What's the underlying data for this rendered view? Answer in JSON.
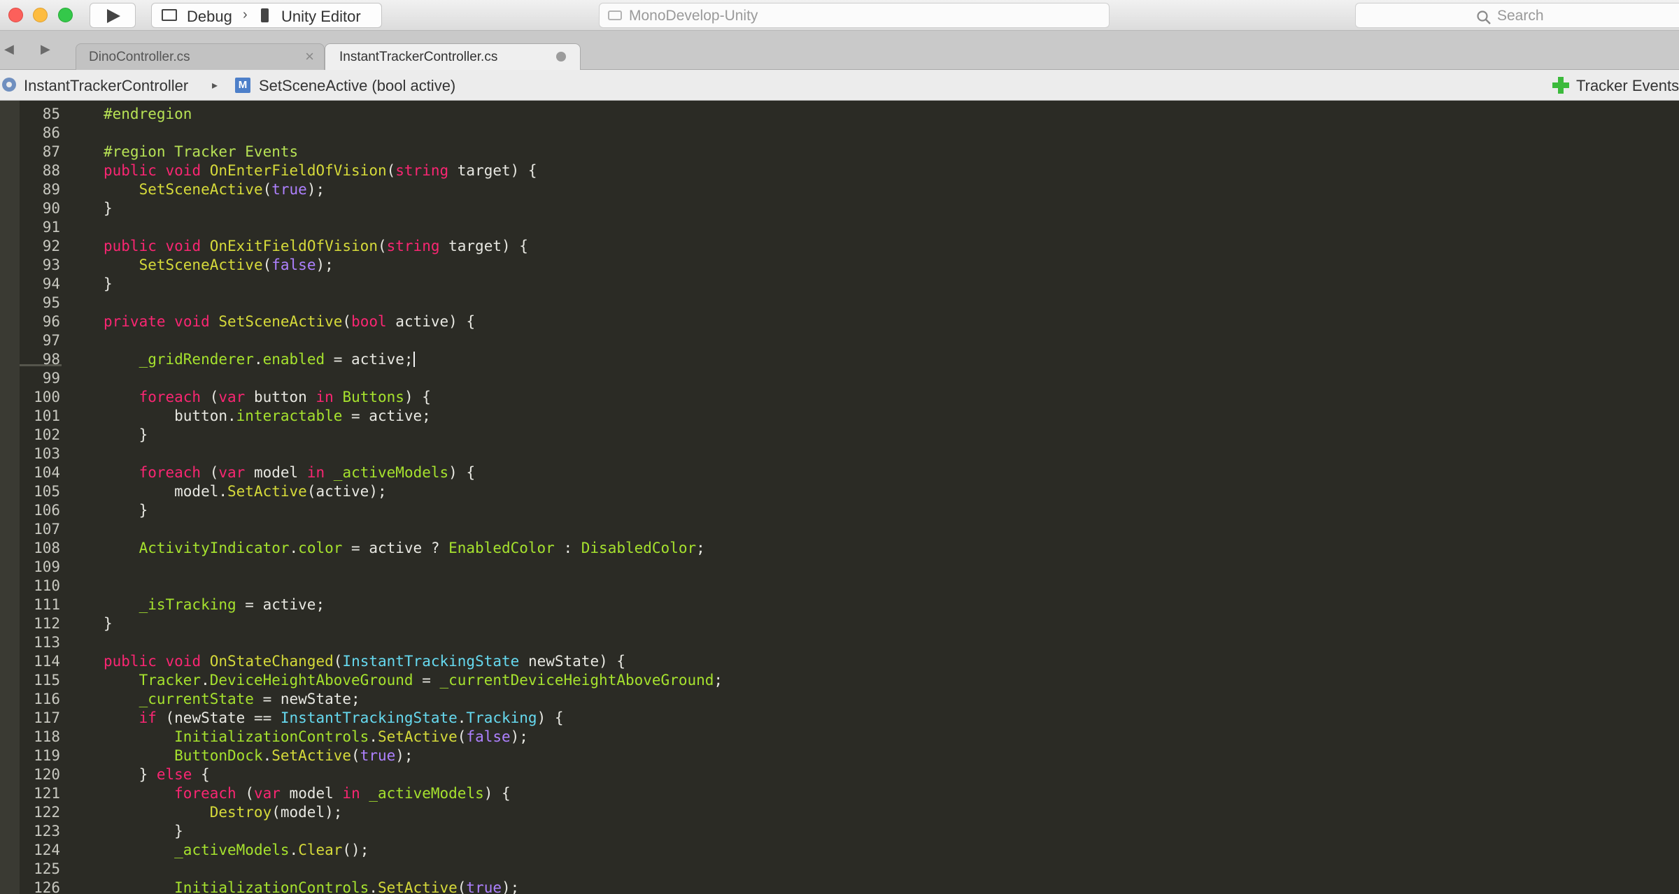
{
  "toolbar": {
    "config": "Debug",
    "separator": "›",
    "target": "Unity Editor",
    "app_title": "MonoDevelop-Unity",
    "search_placeholder": "Search"
  },
  "tabs": [
    {
      "label": "DinoController.cs",
      "close": "×"
    },
    {
      "label": "InstantTrackerController.cs"
    }
  ],
  "nav": {
    "back": "◀",
    "forward": "▶"
  },
  "breadcrumb": {
    "class_name": "InstantTrackerController",
    "arrow": "▸",
    "method_icon_letter": "M",
    "method": "SetSceneActive (bool active)",
    "region": "Tracker Events"
  },
  "code": {
    "colors": {
      "keyword": "#f92672",
      "type": "#66d9ef",
      "function": "#d6da3a",
      "property": "#a6e22e",
      "literal": "#ae81ff",
      "text": "#e8e8e2",
      "background": "#2b2b25"
    },
    "lines": [
      {
        "n": "85",
        "tokens": [
          [
            "rg",
            "#endregion"
          ]
        ]
      },
      {
        "n": "86",
        "tokens": []
      },
      {
        "n": "87",
        "tokens": [
          [
            "rg",
            "#region Tracker Events"
          ]
        ]
      },
      {
        "n": "88",
        "tokens": [
          [
            "kw",
            "public"
          ],
          [
            "",
            " "
          ],
          [
            "kw",
            "void"
          ],
          [
            "",
            " "
          ],
          [
            "fn",
            "OnEnterFieldOfVision"
          ],
          [
            "",
            "("
          ],
          [
            "kw",
            "string"
          ],
          [
            "",
            " target) {"
          ]
        ]
      },
      {
        "n": "89",
        "tokens": [
          [
            "",
            "    "
          ],
          [
            "fn",
            "SetSceneActive"
          ],
          [
            "",
            "("
          ],
          [
            "lit",
            "true"
          ],
          [
            "",
            ");"
          ]
        ]
      },
      {
        "n": "90",
        "tokens": [
          [
            "",
            "}"
          ]
        ]
      },
      {
        "n": "91",
        "tokens": []
      },
      {
        "n": "92",
        "tokens": [
          [
            "kw",
            "public"
          ],
          [
            "",
            " "
          ],
          [
            "kw",
            "void"
          ],
          [
            "",
            " "
          ],
          [
            "fn",
            "OnExitFieldOfVision"
          ],
          [
            "",
            "("
          ],
          [
            "kw",
            "string"
          ],
          [
            "",
            " target) {"
          ]
        ]
      },
      {
        "n": "93",
        "tokens": [
          [
            "",
            "    "
          ],
          [
            "fn",
            "SetSceneActive"
          ],
          [
            "",
            "("
          ],
          [
            "lit",
            "false"
          ],
          [
            "",
            ");"
          ]
        ]
      },
      {
        "n": "94",
        "tokens": [
          [
            "",
            "}"
          ]
        ]
      },
      {
        "n": "95",
        "tokens": []
      },
      {
        "n": "96",
        "tokens": [
          [
            "kw",
            "private"
          ],
          [
            "",
            " "
          ],
          [
            "kw",
            "void"
          ],
          [
            "",
            " "
          ],
          [
            "fn",
            "SetSceneActive"
          ],
          [
            "",
            "("
          ],
          [
            "kw",
            "bool"
          ],
          [
            "",
            " active) {"
          ]
        ]
      },
      {
        "n": "97",
        "tokens": []
      },
      {
        "n": "98",
        "tokens": [
          [
            "",
            "    "
          ],
          [
            "pr",
            "_gridRenderer"
          ],
          [
            "",
            "."
          ],
          [
            "pr",
            "enabled"
          ],
          [
            "",
            " = active;"
          ]
        ],
        "cursor": true
      },
      {
        "n": "99",
        "tokens": []
      },
      {
        "n": "100",
        "tokens": [
          [
            "",
            "    "
          ],
          [
            "kw",
            "foreach"
          ],
          [
            "",
            " ("
          ],
          [
            "kw",
            "var"
          ],
          [
            "",
            " button "
          ],
          [
            "kw",
            "in"
          ],
          [
            "",
            " "
          ],
          [
            "pr",
            "Buttons"
          ],
          [
            "",
            ") {"
          ]
        ]
      },
      {
        "n": "101",
        "tokens": [
          [
            "",
            "        button."
          ],
          [
            "pr",
            "interactable"
          ],
          [
            "",
            " = active;"
          ]
        ]
      },
      {
        "n": "102",
        "tokens": [
          [
            "",
            "    }"
          ]
        ]
      },
      {
        "n": "103",
        "tokens": []
      },
      {
        "n": "104",
        "tokens": [
          [
            "",
            "    "
          ],
          [
            "kw",
            "foreach"
          ],
          [
            "",
            " ("
          ],
          [
            "kw",
            "var"
          ],
          [
            "",
            " model "
          ],
          [
            "kw",
            "in"
          ],
          [
            "",
            " "
          ],
          [
            "pr",
            "_activeModels"
          ],
          [
            "",
            ") {"
          ]
        ]
      },
      {
        "n": "105",
        "tokens": [
          [
            "",
            "        model."
          ],
          [
            "fn",
            "SetActive"
          ],
          [
            "",
            "(active);"
          ]
        ]
      },
      {
        "n": "106",
        "tokens": [
          [
            "",
            "    }"
          ]
        ]
      },
      {
        "n": "107",
        "tokens": []
      },
      {
        "n": "108",
        "tokens": [
          [
            "",
            "    "
          ],
          [
            "pr",
            "ActivityIndicator"
          ],
          [
            "",
            "."
          ],
          [
            "pr",
            "color"
          ],
          [
            "",
            " = active ? "
          ],
          [
            "pr",
            "EnabledColor"
          ],
          [
            "",
            " : "
          ],
          [
            "pr",
            "DisabledColor"
          ],
          [
            "",
            ";"
          ]
        ]
      },
      {
        "n": "109",
        "tokens": []
      },
      {
        "n": "110",
        "tokens": []
      },
      {
        "n": "111",
        "tokens": [
          [
            "",
            "    "
          ],
          [
            "pr",
            "_isTracking"
          ],
          [
            "",
            " = active;"
          ]
        ]
      },
      {
        "n": "112",
        "tokens": [
          [
            "",
            "}"
          ]
        ]
      },
      {
        "n": "113",
        "tokens": []
      },
      {
        "n": "114",
        "tokens": [
          [
            "kw",
            "public"
          ],
          [
            "",
            " "
          ],
          [
            "kw",
            "void"
          ],
          [
            "",
            " "
          ],
          [
            "fn",
            "OnStateChanged"
          ],
          [
            "",
            "("
          ],
          [
            "ty",
            "InstantTrackingState"
          ],
          [
            "",
            " newState) {"
          ]
        ]
      },
      {
        "n": "115",
        "tokens": [
          [
            "",
            "    "
          ],
          [
            "pr",
            "Tracker"
          ],
          [
            "",
            "."
          ],
          [
            "pr",
            "DeviceHeightAboveGround"
          ],
          [
            "",
            " = "
          ],
          [
            "pr",
            "_currentDeviceHeightAboveGround"
          ],
          [
            "",
            ";"
          ]
        ]
      },
      {
        "n": "116",
        "tokens": [
          [
            "",
            "    "
          ],
          [
            "pr",
            "_currentState"
          ],
          [
            "",
            " = newState;"
          ]
        ]
      },
      {
        "n": "117",
        "tokens": [
          [
            "",
            "    "
          ],
          [
            "kw",
            "if"
          ],
          [
            "",
            " (newState == "
          ],
          [
            "ty",
            "InstantTrackingState"
          ],
          [
            "",
            "."
          ],
          [
            "ty",
            "Tracking"
          ],
          [
            "",
            ") {"
          ]
        ]
      },
      {
        "n": "118",
        "tokens": [
          [
            "",
            "        "
          ],
          [
            "pr",
            "InitializationControls"
          ],
          [
            "",
            "."
          ],
          [
            "fn",
            "SetActive"
          ],
          [
            "",
            "("
          ],
          [
            "lit",
            "false"
          ],
          [
            "",
            ");"
          ]
        ]
      },
      {
        "n": "119",
        "tokens": [
          [
            "",
            "        "
          ],
          [
            "pr",
            "ButtonDock"
          ],
          [
            "",
            "."
          ],
          [
            "fn",
            "SetActive"
          ],
          [
            "",
            "("
          ],
          [
            "lit",
            "true"
          ],
          [
            "",
            ");"
          ]
        ]
      },
      {
        "n": "120",
        "tokens": [
          [
            "",
            "    } "
          ],
          [
            "kw",
            "else"
          ],
          [
            "",
            " {"
          ]
        ]
      },
      {
        "n": "121",
        "tokens": [
          [
            "",
            "        "
          ],
          [
            "kw",
            "foreach"
          ],
          [
            "",
            " ("
          ],
          [
            "kw",
            "var"
          ],
          [
            "",
            " model "
          ],
          [
            "kw",
            "in"
          ],
          [
            "",
            " "
          ],
          [
            "pr",
            "_activeModels"
          ],
          [
            "",
            ") {"
          ]
        ]
      },
      {
        "n": "122",
        "tokens": [
          [
            "",
            "            "
          ],
          [
            "fn",
            "Destroy"
          ],
          [
            "",
            "(model);"
          ]
        ]
      },
      {
        "n": "123",
        "tokens": [
          [
            "",
            "        }"
          ]
        ]
      },
      {
        "n": "124",
        "tokens": [
          [
            "",
            "        "
          ],
          [
            "pr",
            "_activeModels"
          ],
          [
            "",
            "."
          ],
          [
            "fn",
            "Clear"
          ],
          [
            "",
            "();"
          ]
        ]
      },
      {
        "n": "125",
        "tokens": []
      },
      {
        "n": "126",
        "tokens": [
          [
            "",
            "        "
          ],
          [
            "pr",
            "InitializationControls"
          ],
          [
            "",
            "."
          ],
          [
            "fn",
            "SetActive"
          ],
          [
            "",
            "("
          ],
          [
            "lit",
            "true"
          ],
          [
            "",
            ");"
          ]
        ]
      }
    ]
  }
}
